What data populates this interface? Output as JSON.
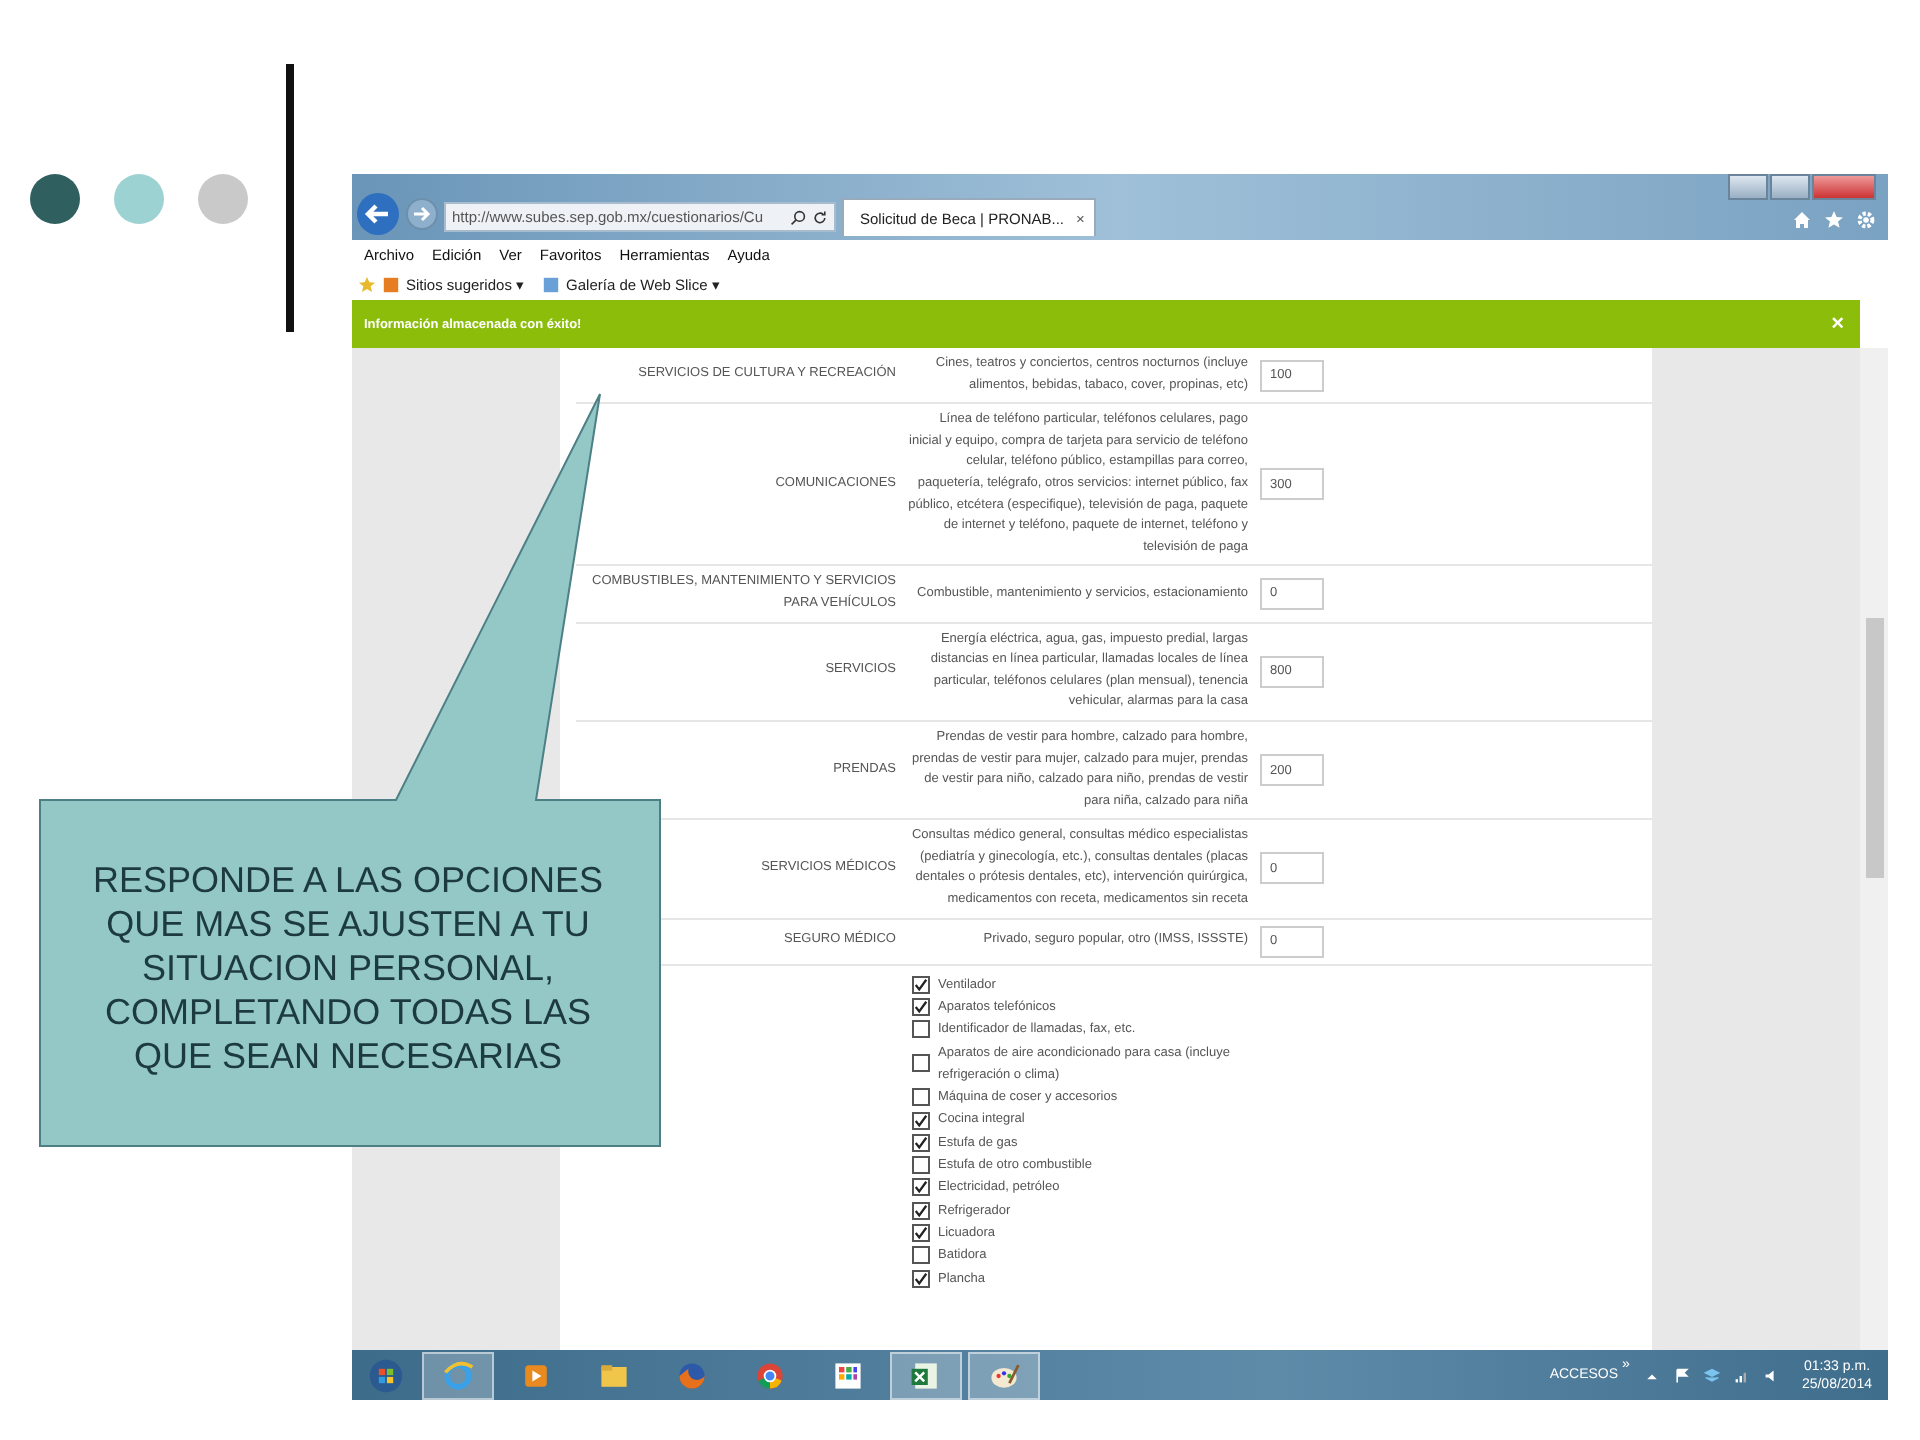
{
  "slide": {
    "dots": [
      {
        "color": "#2f5f5f"
      },
      {
        "color": "#9dd2d2"
      },
      {
        "color": "#c9c9c9"
      }
    ]
  },
  "browser": {
    "address": "http://www.subes.sep.gob.mx/cuestionarios/Cu",
    "tab": {
      "title": "Solicitud de Beca | PRONAB...",
      "close": "×"
    },
    "menu": [
      "Archivo",
      "Edición",
      "Ver",
      "Favoritos",
      "Herramientas",
      "Ayuda"
    ],
    "favorites": [
      "Sitios sugeridos ▾",
      "Galería de Web Slice ▾"
    ],
    "notification": {
      "text": "Información almacenada con éxito!",
      "close": "×"
    }
  },
  "expenses": [
    {
      "category": "SERVICIOS DE CULTURA Y RECREACIÓN",
      "description": "Cines, teatros y conciertos, centros nocturnos (incluye alimentos, bebidas, tabaco, cover, propinas, etc)",
      "value": "100"
    },
    {
      "category": "COMUNICACIONES",
      "description": "Línea de teléfono particular, teléfonos celulares, pago inicial y equipo, compra de tarjeta para servicio de teléfono celular, teléfono público, estampillas para correo, paquetería, telégrafo, otros servicios: internet público, fax público, etcétera (especifique), televisión de paga, paquete de internet y teléfono, paquete de internet, teléfono y televisión de paga",
      "value": "300"
    },
    {
      "category": "COMBUSTIBLES, MANTENIMIENTO Y SERVICIOS PARA VEHÍCULOS",
      "description": "Combustible, mantenimiento y servicios, estacionamiento",
      "value": "0"
    },
    {
      "category": "SERVICIOS",
      "description": "Energía eléctrica, agua, gas, impuesto predial, largas distancias en línea particular, llamadas locales de línea particular, teléfonos celulares (plan mensual), tenencia vehicular, alarmas para la casa",
      "value": "800"
    },
    {
      "category": "PRENDAS",
      "description": "Prendas de vestir para hombre, calzado para hombre, prendas de vestir para mujer, calzado para mujer, prendas de vestir para niño, calzado para niño, prendas de vestir para niña, calzado para niña",
      "value": "200"
    },
    {
      "category": "SERVICIOS MÉDICOS",
      "description": "Consultas médico general, consultas médico especialistas (pediatría y ginecología, etc.), consultas dentales (placas dentales o prótesis dentales, etc), intervención quirúrgica, medicamentos con receta, medicamentos sin receta",
      "value": "0"
    },
    {
      "category": "SEGURO MÉDICO",
      "description": "Privado, seguro popular, otro (IMSS, ISSSTE)",
      "value": "0"
    }
  ],
  "appliances": [
    {
      "label": "Ventilador",
      "checked": true
    },
    {
      "label": "Aparatos telefónicos",
      "checked": true
    },
    {
      "label": "Identificador de llamadas, fax, etc.",
      "checked": false
    },
    {
      "label": "Aparatos de aire acondicionado para casa (incluye refrigeración o clima)",
      "checked": false
    },
    {
      "label": "Máquina de coser y accesorios",
      "checked": false
    },
    {
      "label": "Cocina integral",
      "checked": true
    },
    {
      "label": "Estufa de gas",
      "checked": true
    },
    {
      "label": "Estufa de otro combustible",
      "checked": false
    },
    {
      "label": "Electricidad, petróleo",
      "checked": true
    },
    {
      "label": "Refrigerador",
      "checked": true
    },
    {
      "label": "Licuadora",
      "checked": true
    },
    {
      "label": "Batidora",
      "checked": false
    },
    {
      "label": "Plancha",
      "checked": true
    }
  ],
  "taskbar": {
    "apps": [
      {
        "kind": "start",
        "active": false
      },
      {
        "kind": "browser",
        "active": true
      },
      {
        "kind": "player",
        "active": false
      },
      {
        "kind": "folder",
        "active": false
      },
      {
        "kind": "fox",
        "active": false
      },
      {
        "kind": "chrome",
        "active": false
      },
      {
        "kind": "grid",
        "active": false
      },
      {
        "kind": "sheet",
        "active": true
      },
      {
        "kind": "paint",
        "active": true
      }
    ],
    "toolbar_label": "ACCESOS",
    "chevron": "»",
    "time": "01:33 p.m.",
    "date": "25/08/2014"
  },
  "callout": {
    "text": "RESPONDE A LAS OPCIONES QUE MAS SE AJUSTEN A TU SITUACION PERSONAL, COMPLETANDO TODAS LAS QUE SEAN NECESARIAS"
  }
}
